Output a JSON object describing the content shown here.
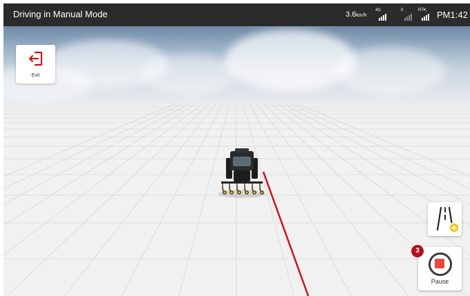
{
  "status_bar": {
    "title": "Driving in Manual Mode",
    "speed_value": "3.6",
    "speed_unit": "km/h",
    "network_label": "4G",
    "satellite_count": "0",
    "rtk_label": "RTK",
    "time": "PM1:42"
  },
  "exit_button": {
    "label": "Exit",
    "icon": "exit-icon"
  },
  "lane_button": {
    "icon": "add-guidance-line-icon"
  },
  "pause_button": {
    "label": "Pause",
    "icon": "stop-record-icon",
    "badge_count": "3"
  },
  "scene": {
    "vehicle": "tractor-with-implement",
    "guidance_line_color": "#c8141e",
    "sky": "cloudy",
    "ground": "grid"
  },
  "colors": {
    "status_bar": "#2b2b2b",
    "accent_red": "#e8473f",
    "badge_red": "#b3121d",
    "exit_icon_red": "#c8141e",
    "plus_yellow": "#f4c51d"
  }
}
